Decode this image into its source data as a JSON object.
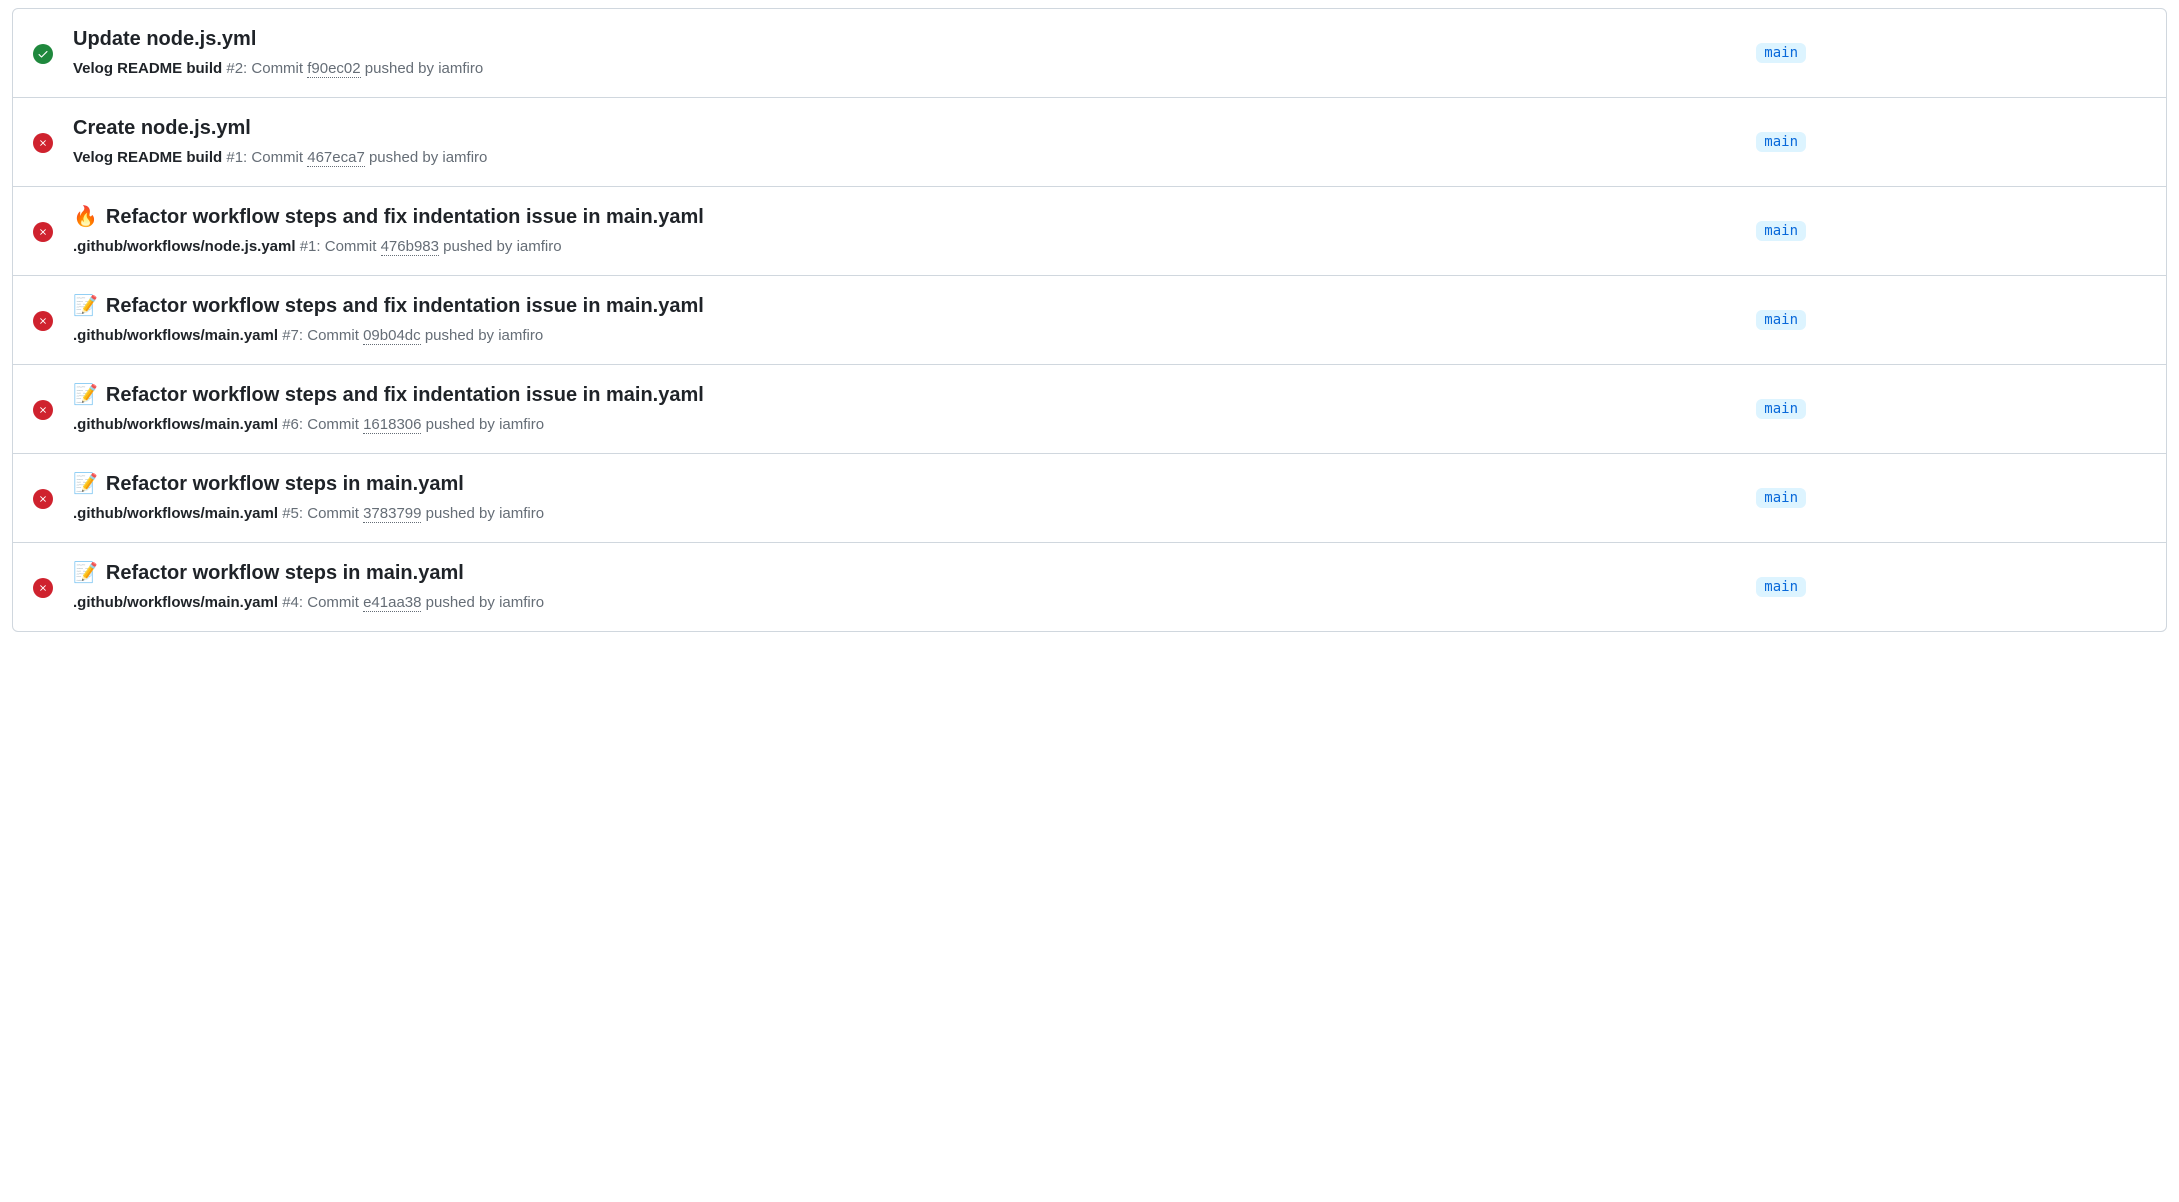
{
  "labels": {
    "commit_prefix": "Commit",
    "pushed_by": "pushed by"
  },
  "runs": [
    {
      "status": "success",
      "emoji": "",
      "title": "Update node.js.yml",
      "workflow": "Velog README build",
      "run_number": "#2",
      "commit": "f90ec02",
      "actor": "iamfiro",
      "branch": "main"
    },
    {
      "status": "failure",
      "emoji": "",
      "title": "Create node.js.yml",
      "workflow": "Velog README build",
      "run_number": "#1",
      "commit": "467eca7",
      "actor": "iamfiro",
      "branch": "main"
    },
    {
      "status": "failure",
      "emoji": "🔥",
      "title": "Refactor workflow steps and fix indentation issue in main.yaml",
      "workflow": ".github/workflows/node.js.yaml",
      "run_number": "#1",
      "commit": "476b983",
      "actor": "iamfiro",
      "branch": "main"
    },
    {
      "status": "failure",
      "emoji": "📝",
      "title": "Refactor workflow steps and fix indentation issue in main.yaml",
      "workflow": ".github/workflows/main.yaml",
      "run_number": "#7",
      "commit": "09b04dc",
      "actor": "iamfiro",
      "branch": "main"
    },
    {
      "status": "failure",
      "emoji": "📝",
      "title": "Refactor workflow steps and fix indentation issue in main.yaml",
      "workflow": ".github/workflows/main.yaml",
      "run_number": "#6",
      "commit": "1618306",
      "actor": "iamfiro",
      "branch": "main"
    },
    {
      "status": "failure",
      "emoji": "📝",
      "title": "Refactor workflow steps in main.yaml",
      "workflow": ".github/workflows/main.yaml",
      "run_number": "#5",
      "commit": "3783799",
      "actor": "iamfiro",
      "branch": "main"
    },
    {
      "status": "failure",
      "emoji": "📝",
      "title": "Refactor workflow steps in main.yaml",
      "workflow": ".github/workflows/main.yaml",
      "run_number": "#4",
      "commit": "e41aa38",
      "actor": "iamfiro",
      "branch": "main"
    }
  ]
}
